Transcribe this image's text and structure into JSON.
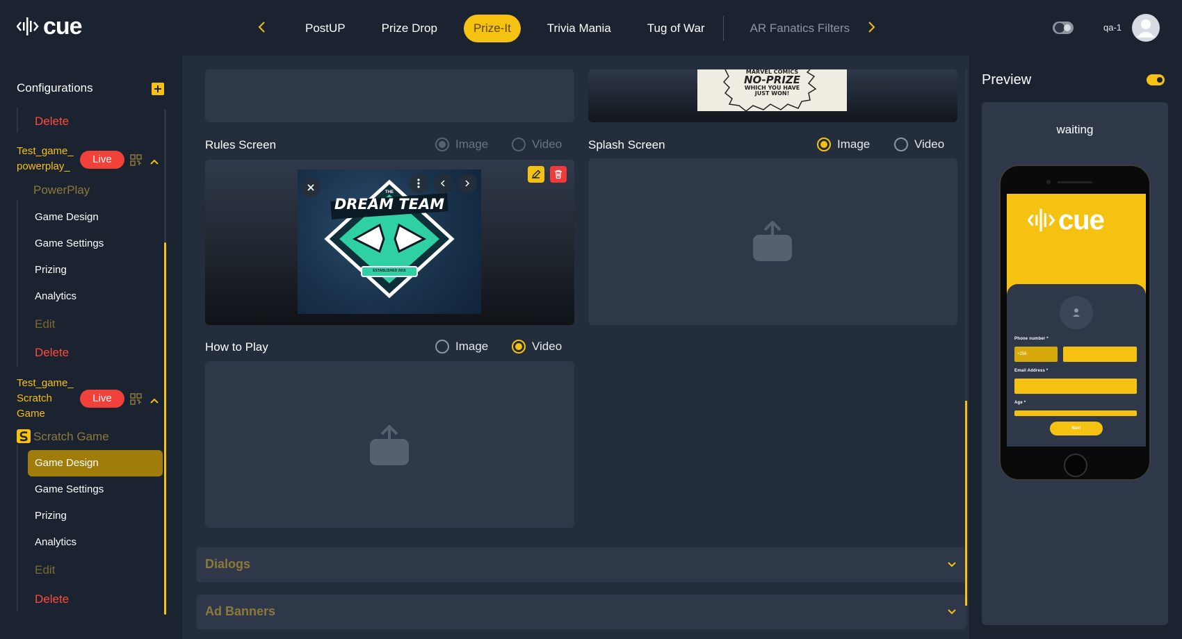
{
  "header": {
    "logo_text": "cue",
    "tabs": [
      {
        "label": "PostUP",
        "state": "normal"
      },
      {
        "label": "Prize Drop",
        "state": "normal"
      },
      {
        "label": "Prize-It",
        "state": "active"
      },
      {
        "label": "Trivia Mania",
        "state": "normal"
      },
      {
        "label": "Tug of War",
        "state": "normal"
      },
      {
        "label": "AR Fanatics Filters",
        "state": "muted"
      }
    ],
    "username": "qa-1"
  },
  "sidebar": {
    "title": "Configurations",
    "top_delete": "Delete",
    "games": [
      {
        "name_lines": [
          "Test_game_",
          "powerplay_"
        ],
        "badge": "Live",
        "section": "PowerPlay",
        "items": [
          "Game Design",
          "Game Settings",
          "Prizing",
          "Analytics"
        ],
        "edit": "Edit",
        "delete": "Delete"
      },
      {
        "name_lines": [
          "Test_game_",
          "Scratch",
          "Game"
        ],
        "badge": "Live",
        "section": "Scratch Game",
        "items": [
          "Game Design",
          "Game Settings",
          "Prizing",
          "Analytics"
        ],
        "active_item": "Game Design",
        "edit": "Edit",
        "delete": "Delete"
      }
    ]
  },
  "main": {
    "noprize_text": [
      "MARVEL COMICS",
      "NO-PRIZE",
      "WHICH YOU HAVE",
      "JUST WON!"
    ],
    "rules": {
      "label": "Rules Screen",
      "options": [
        "Image",
        "Video"
      ],
      "selected": "Image",
      "disabled": true
    },
    "rules_art": {
      "small": "THE",
      "title": "DREAM TEAM",
      "ribbon": "ESTABLISHED 2016"
    },
    "splash": {
      "label": "Splash Screen",
      "options": [
        "Image",
        "Video"
      ],
      "selected": "Image"
    },
    "howto": {
      "label": "How to Play",
      "options": [
        "Image",
        "Video"
      ],
      "selected": "Video"
    },
    "accordions": [
      "Dialogs",
      "Ad Banners"
    ]
  },
  "preview": {
    "title": "Preview",
    "status": "waiting",
    "phone": {
      "logo_text": "cue",
      "phone_label": "Phone number *",
      "code": "+256",
      "email_label": "Email Address *",
      "age_label": "Age *",
      "next_label": "Next"
    }
  },
  "colors": {
    "accent": "#f5c211",
    "live": "#f0413b",
    "danger": "#ff4a3d",
    "bg": "#1b2230",
    "panel": "#2e3849"
  },
  "icons": [
    "cue-logo-icon",
    "chevron-left-icon",
    "chevron-right-icon",
    "theme-toggle-icon",
    "user-avatar-icon",
    "plus-icon",
    "qr-code-icon",
    "chevron-up-icon",
    "close-icon",
    "more-vertical-icon",
    "pencil-icon",
    "trash-icon",
    "upload-icon",
    "chevron-down-icon"
  ]
}
